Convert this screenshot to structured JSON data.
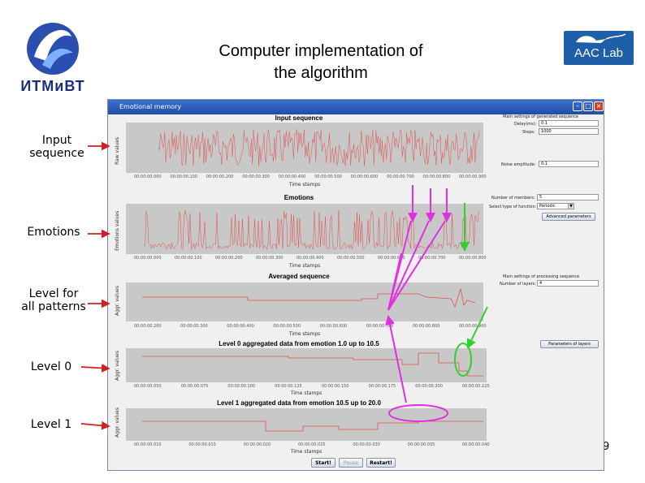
{
  "slide": {
    "title_line1": "Computer implementation of",
    "title_line2": "the algorithm",
    "page_number": "9",
    "left_logo_text": "ИТМиВТ",
    "right_logo_text": "AAC Lab"
  },
  "side_labels": {
    "input_sequence": "Input\nsequence",
    "emotions": "Emotions",
    "level_all": "Level for\nall patterns",
    "level0": "Level 0",
    "level1": "Level 1"
  },
  "window": {
    "title": "Emotional memory"
  },
  "panels": {
    "input": {
      "title": "Input sequence",
      "ylabel": "Raw values",
      "xlabel": "Time stamps",
      "ticks": [
        "00:00:00.000",
        "00:00:00.100",
        "00:00:00.200",
        "00:00:00.300",
        "00:00:00.400",
        "00:00:00.500",
        "00:00:00.600",
        "00:00:00.700",
        "00:00:00.800",
        "00:00:00.900"
      ]
    },
    "emotions": {
      "title": "Emotions",
      "ylabel": "Emotions values",
      "xlabel": "Time stamps",
      "ticks": [
        "00:00:00.000",
        "00:00:00.100",
        "00:00:00.200",
        "00:00:00.300",
        "00:00:00.400",
        "00:00:00.500",
        "00:00:00.600",
        "00:00:00.700",
        "00:00:00.800"
      ]
    },
    "averaged": {
      "title": "Averaged sequence",
      "ylabel": "Aggr. values",
      "xlabel": "Time stamps",
      "ticks": [
        "00:00:00.200",
        "00:00:00.300",
        "00:00:00.400",
        "00:00:00.500",
        "00:00:00.600",
        "00:00:00.700",
        "00:00:00.800",
        "00:00:00.900"
      ]
    },
    "level0": {
      "title": "Level 0 aggregated data from emotion 1.0 up to 10.5",
      "ylabel": "Aggr. values",
      "xlabel": "Time stamps",
      "ticks": [
        "00:00:00.050",
        "00:00:00.075",
        "00:00:00.100",
        "00:00:00.125",
        "00:00:00.150",
        "00:00:00.175",
        "00:00:00.200",
        "00:00:00.225"
      ]
    },
    "level1": {
      "title": "Level 1 aggregated data from emotion 10.5 up to 20.0",
      "ylabel": "Aggr. values",
      "xlabel": "Time stamps",
      "ticks": [
        "00:00:00.010",
        "00:00:00.015",
        "00:00:00.020",
        "00:00:00.025",
        "00:00:00.030",
        "00:00:00.035",
        "00:00:00.040"
      ]
    }
  },
  "controls": {
    "generated_header": "Main settings of generated sequence",
    "delay_label": "Delay(ms):",
    "delay_value": "0.1",
    "steps_label": "Steps:",
    "steps_value": "1000",
    "noise_label": "Noise amplitude:",
    "noise_value": "0.1",
    "num_members_label": "Number of members:",
    "num_members_value": "5",
    "func_type_label": "Select type of function:",
    "func_type_value": "Periodic",
    "advanced_button": "Advanced parameters",
    "processing_header": "Main settings of processing sequence",
    "layers_label": "Number of layers:",
    "layers_value": "4",
    "layers_button": "Parameters of layers",
    "start_button": "Start!",
    "pause_button": "Pause",
    "restart_button": "Restart!"
  },
  "colors": {
    "series": "#e05050",
    "panel_bg": "#c8c8c8",
    "annotation_magenta": "#e030e0",
    "annotation_green": "#30d030",
    "arrow_red": "#d02020"
  }
}
